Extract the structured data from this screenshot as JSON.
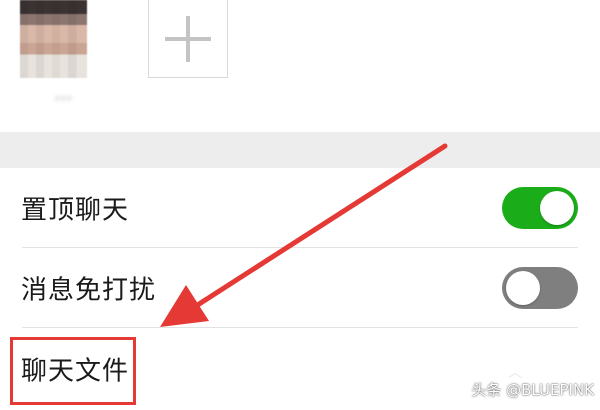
{
  "members": {
    "avatar_name": "•••"
  },
  "settings": {
    "items": [
      {
        "label": "置顶聊天",
        "toggle_on": true
      },
      {
        "label": "消息免打扰",
        "toggle_on": false
      },
      {
        "label": "聊天文件"
      }
    ]
  },
  "watermark": "头条 @BLUEPINK",
  "colors": {
    "accent": "#1aad19",
    "annotation": "#e53935",
    "section_gap": "#ededed"
  },
  "icons": {
    "add_member": "plus-icon",
    "annotation": "red-arrow"
  }
}
